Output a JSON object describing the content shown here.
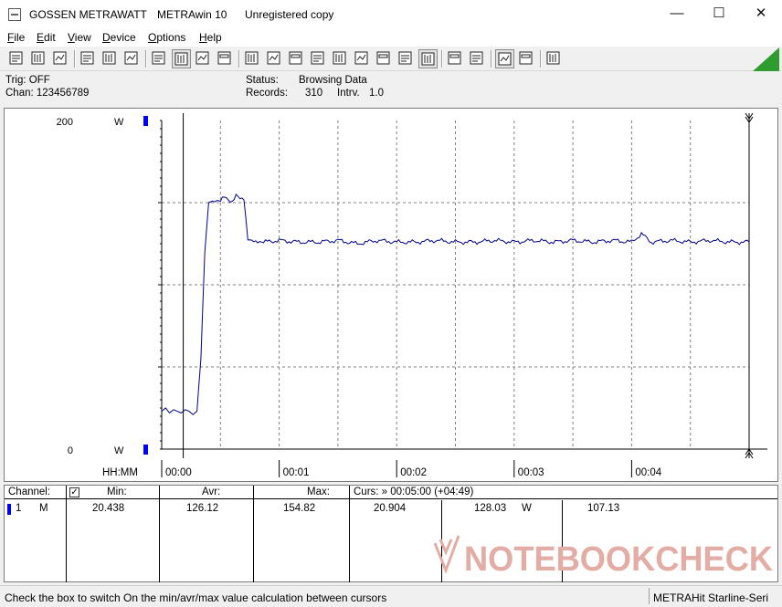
{
  "window": {
    "title_parts": [
      "GOSSEN METRAWATT",
      "METRAwin 10",
      "Unregistered copy"
    ],
    "controls": {
      "minimize": "—",
      "maximize": "☐",
      "close": "✕"
    }
  },
  "menu": [
    "File",
    "Edit",
    "View",
    "Device",
    "Options",
    "Help"
  ],
  "menu_underline": [
    "F",
    "E",
    "V",
    "D",
    "O",
    "H"
  ],
  "info": {
    "trig": "Trig: OFF",
    "chan": "Chan:  123456789",
    "status_label": "Status:",
    "status_value": "Browsing Data",
    "records_label": "Records:",
    "records_value": "310",
    "intrv_label": "Intrv.",
    "intrv_value": "1.0"
  },
  "chart_data": {
    "type": "line",
    "y_top_label": "200",
    "y_bottom_label": "0",
    "y_unit": "W",
    "ylim": [
      0,
      200
    ],
    "x_axis_label": "HH:MM",
    "x_ticks": [
      "00:00",
      "00:01",
      "00:02",
      "00:03",
      "00:04"
    ],
    "x_range_seconds": [
      0,
      300
    ],
    "cursor_positions_seconds": [
      11,
      300
    ],
    "grid": true,
    "line_color": "#00008b",
    "series": [
      {
        "x": [
          0,
          2,
          4,
          6,
          8,
          10,
          12,
          14,
          16,
          18,
          20,
          22,
          24,
          26,
          28,
          30,
          32,
          34,
          36,
          38,
          40,
          42,
          44,
          46,
          48,
          50,
          52,
          60,
          70,
          80,
          90,
          100,
          110,
          120,
          130,
          140,
          150,
          160,
          170,
          180,
          190,
          200,
          210,
          220,
          230,
          240,
          245,
          250,
          260,
          270,
          280,
          290,
          300
        ],
        "y": [
          23,
          25,
          22,
          24,
          23,
          22,
          24,
          23,
          21,
          23,
          55,
          120,
          150,
          151,
          152,
          151,
          153,
          152,
          151,
          154,
          152,
          153,
          128,
          126,
          126,
          127,
          126,
          127,
          126,
          126,
          127,
          125,
          127,
          126,
          126,
          127,
          126,
          126,
          127,
          126,
          127,
          126,
          127,
          126,
          127,
          126,
          131,
          126,
          127,
          126,
          127,
          126,
          126
        ]
      }
    ]
  },
  "table": {
    "headers": {
      "channel": "Channel:",
      "min": "Min:",
      "avr": "Avr:",
      "max": "Max:",
      "curs": "Curs: » 00:05:00 (+04:49)"
    },
    "row": {
      "channel_no": "1",
      "mode": "M",
      "min": "20.438",
      "avr": "126.12",
      "max": "154.82",
      "curs_min": "20.904",
      "curs_avr": "128.03",
      "curs_unit": "W",
      "curs_max": "107.13"
    }
  },
  "watermark": "NOTEBOOKCHECK",
  "status": {
    "hint": "Check the box to switch On the min/avr/max value calculation between cursors",
    "device": "METRAHit Starline-Seri"
  },
  "colors": {
    "channel_marker": "#0000ff",
    "plot_line": "#00008b",
    "watermark": "#e0a8a0",
    "accent_green": "#2e9c2e"
  }
}
